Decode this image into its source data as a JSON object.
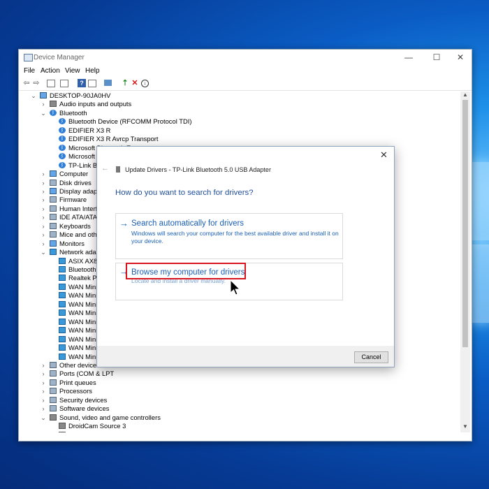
{
  "window": {
    "title": "Device Manager",
    "controls": {
      "minimize": "—",
      "maximize": "☐",
      "close": "✕"
    }
  },
  "menu": [
    "File",
    "Action",
    "View",
    "Help"
  ],
  "tree": [
    {
      "label": "DESKTOP-90JA0HV",
      "level": 0,
      "chev": "⌄",
      "icon": "computer-icon"
    },
    {
      "label": "Audio inputs and outputs",
      "level": 1,
      "chev": "›",
      "icon": "speaker-icon"
    },
    {
      "label": "Bluetooth",
      "level": 1,
      "chev": "⌄",
      "icon": "bluetooth-icon"
    },
    {
      "label": "Bluetooth Device (RFCOMM Protocol TDI)",
      "level": 2,
      "chev": "",
      "icon": "bluetooth-icon"
    },
    {
      "label": "EDIFIER X3 R",
      "level": 2,
      "chev": "",
      "icon": "bluetooth-icon"
    },
    {
      "label": "EDIFIER X3 R Avrcp Transport",
      "level": 2,
      "chev": "",
      "icon": "bluetooth-icon"
    },
    {
      "label": "Microsoft Bluetooth Enumerator",
      "level": 2,
      "chev": "",
      "icon": "bluetooth-icon"
    },
    {
      "label": "Microsoft Blue",
      "level": 2,
      "chev": "",
      "icon": "bluetooth-icon"
    },
    {
      "label": "TP-Link Blueto",
      "level": 2,
      "chev": "",
      "icon": "bluetooth-icon"
    },
    {
      "label": "Computer",
      "level": 1,
      "chev": "›",
      "icon": "computer-icon"
    },
    {
      "label": "Disk drives",
      "level": 1,
      "chev": "›",
      "icon": "disk-icon"
    },
    {
      "label": "Display adapters",
      "level": 1,
      "chev": "›",
      "icon": "display-icon"
    },
    {
      "label": "Firmware",
      "level": 1,
      "chev": "›",
      "icon": "firmware-icon"
    },
    {
      "label": "Human Interface D",
      "level": 1,
      "chev": "›",
      "icon": "hid-icon"
    },
    {
      "label": "IDE ATA/ATAPI cor",
      "level": 1,
      "chev": "›",
      "icon": "ide-icon"
    },
    {
      "label": "Keyboards",
      "level": 1,
      "chev": "›",
      "icon": "keyboard-icon"
    },
    {
      "label": "Mice and other po",
      "level": 1,
      "chev": "›",
      "icon": "mouse-icon"
    },
    {
      "label": "Monitors",
      "level": 1,
      "chev": "›",
      "icon": "monitor-icon"
    },
    {
      "label": "Network adapters",
      "level": 1,
      "chev": "⌄",
      "icon": "network-icon"
    },
    {
      "label": "ASIX AX88179 G",
      "level": 2,
      "chev": "",
      "icon": "network-icon"
    },
    {
      "label": "Bluetooth Devic",
      "level": 2,
      "chev": "",
      "icon": "network-icon"
    },
    {
      "label": "Realtek PCIe G",
      "level": 2,
      "chev": "",
      "icon": "network-icon"
    },
    {
      "label": "WAN Miniport",
      "level": 2,
      "chev": "",
      "icon": "network-icon"
    },
    {
      "label": "WAN Miniport",
      "level": 2,
      "chev": "",
      "icon": "network-icon"
    },
    {
      "label": "WAN Miniport",
      "level": 2,
      "chev": "",
      "icon": "network-icon"
    },
    {
      "label": "WAN Miniport",
      "level": 2,
      "chev": "",
      "icon": "network-icon"
    },
    {
      "label": "WAN Miniport",
      "level": 2,
      "chev": "",
      "icon": "network-icon"
    },
    {
      "label": "WAN Miniport",
      "level": 2,
      "chev": "",
      "icon": "network-icon"
    },
    {
      "label": "WAN Miniport",
      "level": 2,
      "chev": "",
      "icon": "network-icon"
    },
    {
      "label": "WAN Miniport",
      "level": 2,
      "chev": "",
      "icon": "network-icon"
    },
    {
      "label": "WAN Miniport",
      "level": 2,
      "chev": "",
      "icon": "network-icon"
    },
    {
      "label": "Other devices",
      "level": 1,
      "chev": "›",
      "icon": "unknown-device-icon"
    },
    {
      "label": "Ports (COM & LPT",
      "level": 1,
      "chev": "›",
      "icon": "port-icon"
    },
    {
      "label": "Print queues",
      "level": 1,
      "chev": "›",
      "icon": "printer-icon"
    },
    {
      "label": "Processors",
      "level": 1,
      "chev": "›",
      "icon": "processor-icon"
    },
    {
      "label": "Security devices",
      "level": 1,
      "chev": "›",
      "icon": "security-icon"
    },
    {
      "label": "Software devices",
      "level": 1,
      "chev": "›",
      "icon": "software-icon"
    },
    {
      "label": "Sound, video and game controllers",
      "level": 1,
      "chev": "⌄",
      "icon": "speaker-icon"
    },
    {
      "label": "DroidCam Source 3",
      "level": 2,
      "chev": "",
      "icon": "speaker-icon"
    },
    {
      "label": "DroidCam Virtual Audio",
      "level": 2,
      "chev": "",
      "icon": "speaker-icon"
    }
  ],
  "dialog": {
    "title": "Update Drivers - TP-Link Bluetooth 5.0 USB Adapter",
    "question": "How do you want to search for drivers?",
    "option1": {
      "title": "Search automatically for drivers",
      "desc_line1": "Windows will search your computer for the best available driver and install it on",
      "desc_line2": "your device."
    },
    "option2": {
      "title": "Browse my computer for drivers",
      "desc": "Locate and install a driver manually."
    },
    "cancel": "Cancel",
    "close": "✕",
    "back": "←",
    "highlight_color": "#d8141e",
    "link_color": "#1a5fb4"
  }
}
